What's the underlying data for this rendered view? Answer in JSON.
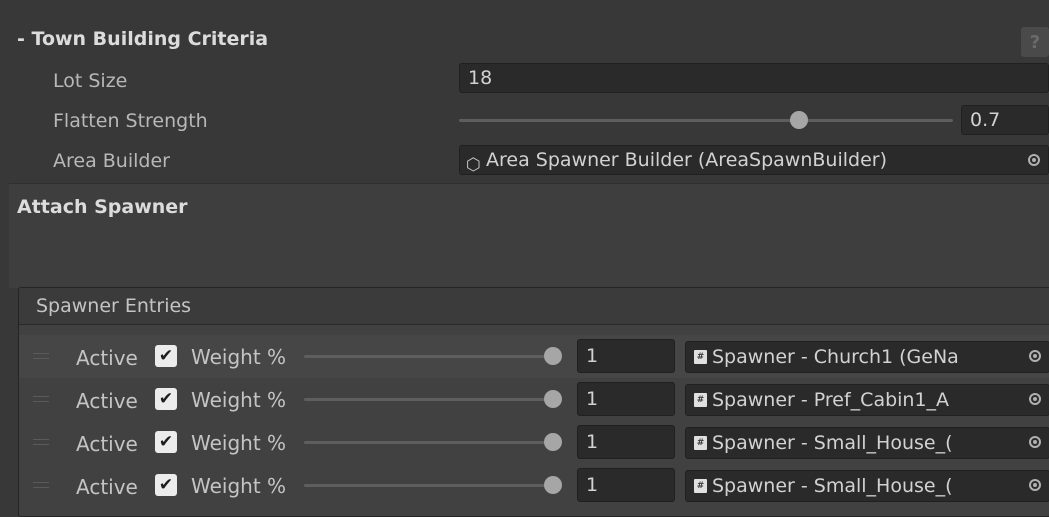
{
  "header": {
    "title": "- Town Building Criteria",
    "help": "?"
  },
  "lot_size": {
    "label": "Lot Size",
    "value": "18"
  },
  "flatten_strength": {
    "label": "Flatten Strength",
    "value": "0.7",
    "fraction": 0.7
  },
  "area_builder": {
    "label": "Area Builder",
    "value": "Area Spawner Builder (AreaSpawnBuilder)"
  },
  "attach_spawner": {
    "title": "Attach Spawner"
  },
  "spawner_entries": {
    "title": "Spawner Entries",
    "rows": [
      {
        "active_label": "Active",
        "checked": true,
        "weight_label": "Weight %",
        "weight": "1",
        "spawner": "Spawner - Church1 (GeNa"
      },
      {
        "active_label": "Active",
        "checked": true,
        "weight_label": "Weight %",
        "weight": "1",
        "spawner": "Spawner - Pref_Cabin1_A"
      },
      {
        "active_label": "Active",
        "checked": true,
        "weight_label": "Weight %",
        "weight": "1",
        "spawner": "Spawner - Small_House_("
      },
      {
        "active_label": "Active",
        "checked": true,
        "weight_label": "Weight %",
        "weight": "1",
        "spawner": "Spawner - Small_House_("
      }
    ]
  },
  "icons": {
    "check": "✔",
    "help": "question-icon",
    "picker": "object-picker-icon",
    "script": "script-icon",
    "prefab": "prefab-icon"
  },
  "colors": {
    "background": "#383838",
    "field": "#2a2a2a",
    "text": "#c4c4c4"
  }
}
